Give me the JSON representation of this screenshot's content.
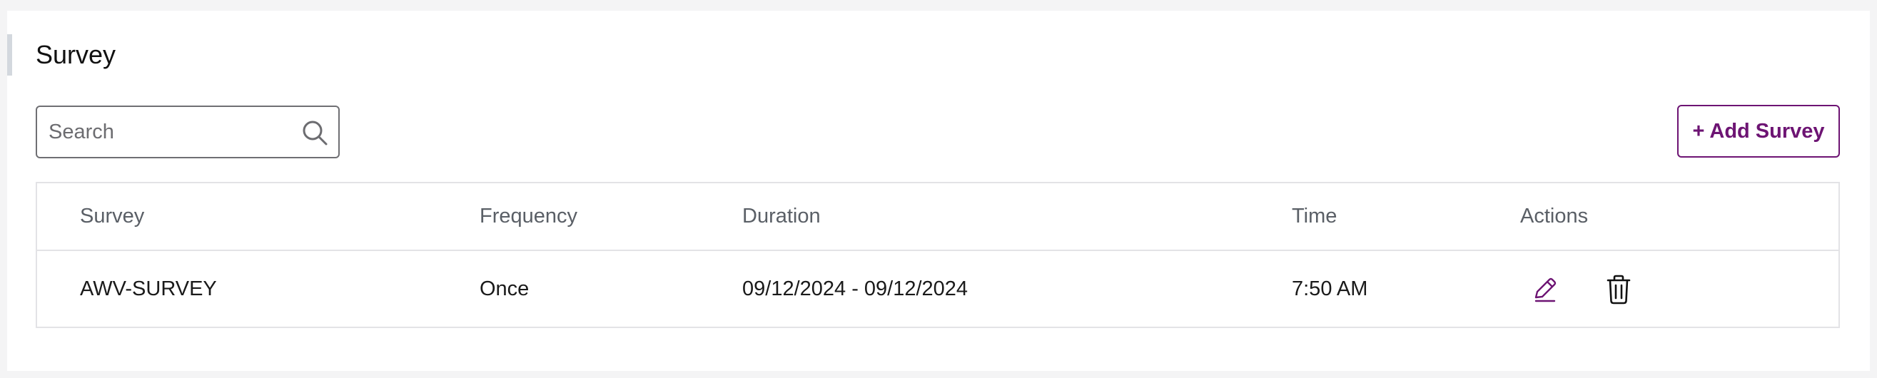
{
  "page": {
    "title": "Survey"
  },
  "search": {
    "placeholder": "Search",
    "value": "",
    "icon": "search-icon"
  },
  "toolbar": {
    "add_label": "+ Add Survey"
  },
  "table": {
    "headers": {
      "survey": "Survey",
      "frequency": "Frequency",
      "duration": "Duration",
      "time": "Time",
      "actions": "Actions"
    },
    "rows": [
      {
        "survey": "AWV-SURVEY",
        "frequency": "Once",
        "duration": "09/12/2024 - 09/12/2024",
        "time": "7:50 AM",
        "actions": [
          "edit-icon",
          "trash-icon"
        ]
      }
    ]
  },
  "colors": {
    "brand": "#6d1473",
    "accent_bar": "#d3d8de",
    "border": "#e3e3e6",
    "header_text": "#5a5f66"
  }
}
